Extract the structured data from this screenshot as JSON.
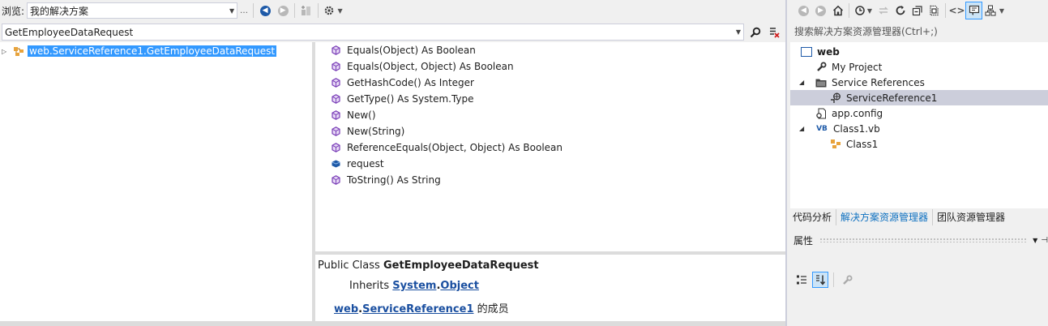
{
  "object_browser": {
    "browse_label": "浏览:",
    "scope_value": "我的解决方案",
    "search_value": "GetEmployeeDataRequest",
    "tree": {
      "selected_item": "web.ServiceReference1.GetEmployeeDataRequest"
    },
    "members": [
      {
        "label": "Equals(Object) As Boolean",
        "icon": "method-icon"
      },
      {
        "label": "Equals(Object, Object) As Boolean",
        "icon": "method-icon"
      },
      {
        "label": "GetHashCode() As Integer",
        "icon": "method-icon"
      },
      {
        "label": "GetType() As System.Type",
        "icon": "method-icon"
      },
      {
        "label": "New()",
        "icon": "method-icon"
      },
      {
        "label": "New(String)",
        "icon": "method-icon"
      },
      {
        "label": "ReferenceEquals(Object, Object) As Boolean",
        "icon": "method-icon"
      },
      {
        "label": "request",
        "icon": "field-icon"
      },
      {
        "label": "ToString() As String",
        "icon": "method-icon"
      }
    ],
    "description": {
      "decl_prefix": "Public Class ",
      "decl_name": "GetEmployeeDataRequest",
      "inherits_label": "Inherits ",
      "inherits_ns": "System",
      "inherits_dot": ".",
      "inherits_type": "Object",
      "member_of_ns": "web",
      "member_of_dot": ".",
      "member_of_type": "ServiceReference1",
      "member_of_suffix": " 的成员"
    }
  },
  "solution_explorer": {
    "search_placeholder": "搜索解决方案资源管理器(Ctrl+;)",
    "items": [
      {
        "label": "web",
        "icon": "vb-project-icon"
      },
      {
        "label": "My Project",
        "icon": "wrench-icon"
      },
      {
        "label": "Service References",
        "icon": "folder-icon"
      },
      {
        "label": "ServiceReference1",
        "icon": "service-reference-icon"
      },
      {
        "label": "app.config",
        "icon": "config-file-icon"
      },
      {
        "label": "Class1.vb",
        "icon": "vb-file-icon"
      },
      {
        "label": "Class1",
        "icon": "class-icon"
      }
    ],
    "vb_badge": "VB",
    "tabs": [
      "代码分析",
      "解决方案资源管理器",
      "团队资源管理器"
    ],
    "properties_title": "属性"
  },
  "colors": {
    "selection": "#3399ff",
    "accent": "#0e70c0",
    "link": "#1a4fa0",
    "method_icon": "#7b3fb8",
    "field_icon": "#1e5aa8"
  }
}
